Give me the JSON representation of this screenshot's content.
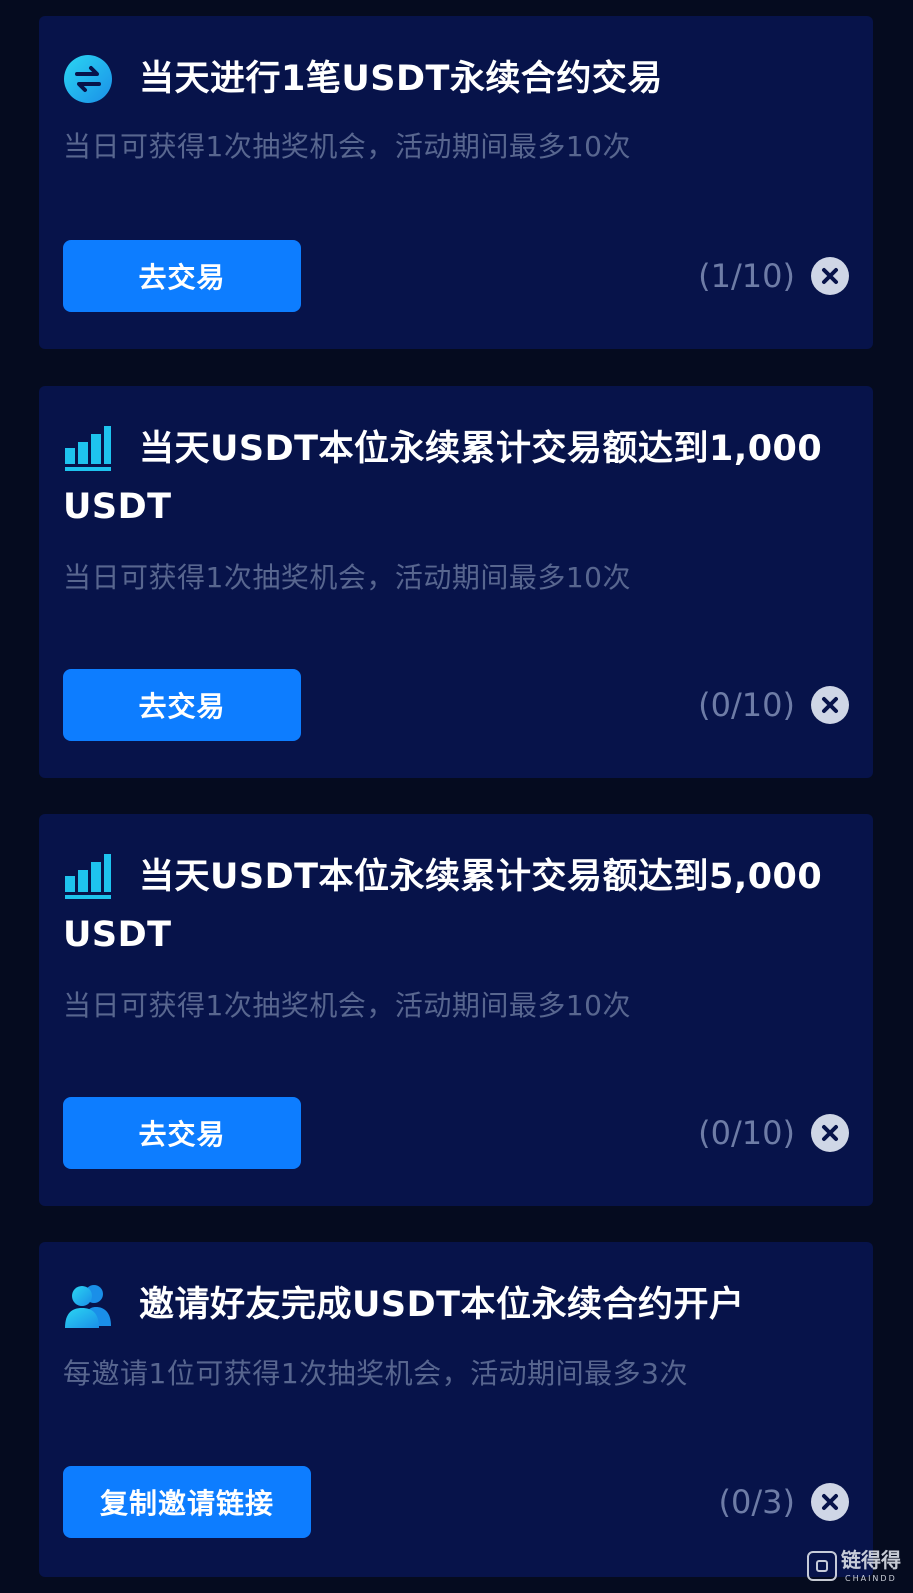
{
  "colors": {
    "page_background": "#050b1f",
    "card_background": "#07134a",
    "button": "#0d7dff",
    "title": "#ffffff",
    "description": "#58668f",
    "progress": "#6e7ca6",
    "icon_accent": "#1ec3ee"
  },
  "tasks": [
    {
      "icon": "swap-icon",
      "title": "当天进行1笔USDT永续合约交易",
      "description": "当日可获得1次抽奖机会，活动期间最多10次",
      "button_label": "去交易",
      "progress": "(1/10)",
      "status_icon": "close-icon"
    },
    {
      "icon": "bar-chart-icon",
      "title": "当天USDT本位永续累计交易额达到1,000 USDT",
      "description": "当日可获得1次抽奖机会，活动期间最多10次",
      "button_label": "去交易",
      "progress": "(0/10)",
      "status_icon": "close-icon"
    },
    {
      "icon": "bar-chart-icon",
      "title": "当天USDT本位永续累计交易额达到5,000 USDT",
      "description": "当日可获得1次抽奖机会，活动期间最多10次",
      "button_label": "去交易",
      "progress": "(0/10)",
      "status_icon": "close-icon"
    },
    {
      "icon": "users-icon",
      "title": "邀请好友完成USDT本位永续合约开户",
      "description": "每邀请1位可获得1次抽奖机会，活动期间最多3次",
      "button_label": "复制邀请链接",
      "progress": "(0/3)",
      "status_icon": "close-icon"
    }
  ],
  "watermark": {
    "text": "链得得",
    "subtext": "CHAINDD"
  }
}
